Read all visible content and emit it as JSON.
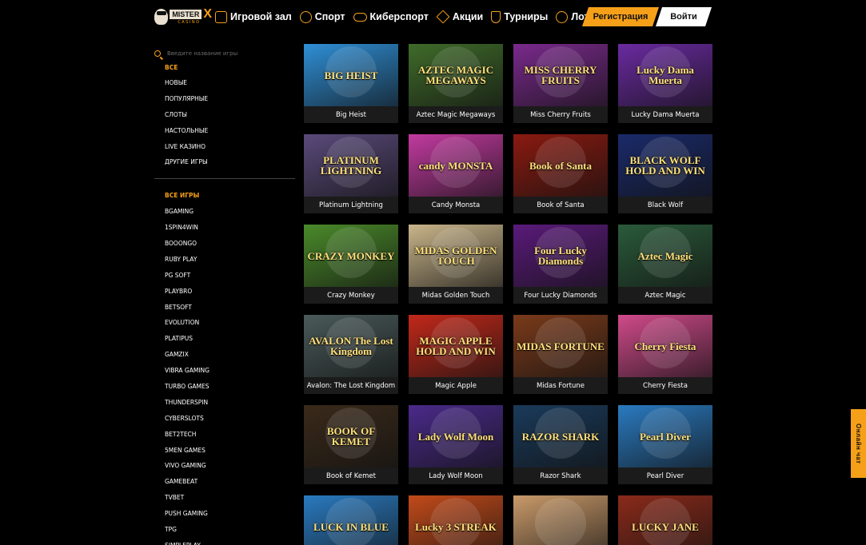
{
  "header": {
    "logo_main": "MISTER",
    "logo_x": "X",
    "logo_sub": "CASINO",
    "nav": [
      {
        "label": "Игровой зал",
        "icon": "slot-machine-icon"
      },
      {
        "label": "Спорт",
        "icon": "ball-icon"
      },
      {
        "label": "Киберспорт",
        "icon": "gamepad-icon"
      },
      {
        "label": "Акции",
        "icon": "diamond-icon"
      },
      {
        "label": "Турниры",
        "icon": "trophy-icon"
      },
      {
        "label": "Лотереи",
        "icon": "lottery-icon"
      }
    ],
    "register_label": "Регистрация",
    "login_label": "Войти"
  },
  "sidebar": {
    "search_placeholder": "Введите название игры",
    "categories": [
      "ВСЕ",
      "НОВЫЕ",
      "ПОПУЛЯРНЫЕ",
      "СЛОТЫ",
      "НАСТОЛЬНЫЕ",
      "LIVE КАЗИНО",
      "ДРУГИЕ ИГРЫ"
    ],
    "providers": [
      "ВСЕ ИГРЫ",
      "BGAMING",
      "1SPIN4WIN",
      "BOOONGO",
      "RUBY PLAY",
      "PG SOFT",
      "PLAYBRO",
      "BETSOFT",
      "EVOLUTION",
      "PLATIPUS",
      "GAMZIX",
      "VIBRA GAMING",
      "TURBO GAMES",
      "THUNDERSPIN",
      "CYBERSLOTS",
      "BET2TECH",
      "5MEN GAMES",
      "VIVO GAMING",
      "GAMEBEAT",
      "TVBET",
      "PUSH GAMING",
      "TPG",
      "SIMPLEPLAY"
    ]
  },
  "games": [
    {
      "name": "Big Heist",
      "logo": "BIG HEIST",
      "bg": "#2f8fd6"
    },
    {
      "name": "Aztec Magic Megaways",
      "logo": "AZTEC MAGIC MEGAWAYS",
      "bg": "#3f6b2a"
    },
    {
      "name": "Miss Cherry Fruits",
      "logo": "MISS CHERRY FRUITS",
      "bg": "#7a2a8c"
    },
    {
      "name": "Lucky Dama Muerta",
      "logo": "Lucky Dama Muerta",
      "bg": "#6a2aa0"
    },
    {
      "name": "Platinum Lightning",
      "logo": "PLATINUM LIGHTNING",
      "bg": "#5a4a7a"
    },
    {
      "name": "Candy Monsta",
      "logo": "candy MONSTA",
      "bg": "#c23aa0"
    },
    {
      "name": "Book of Santa",
      "logo": "Book of Santa",
      "bg": "#8a1a10"
    },
    {
      "name": "Black Wolf",
      "logo": "BLACK WOLF HOLD AND WIN",
      "bg": "#1a2a6a"
    },
    {
      "name": "Crazy Monkey",
      "logo": "CRAZY MONKEY",
      "bg": "#4a8a2a"
    },
    {
      "name": "Midas Golden Touch",
      "logo": "MIDAS GOLDEN TOUCH",
      "bg": "#c9b58a"
    },
    {
      "name": "Four Lucky Diamonds",
      "logo": "Four Lucky Diamonds",
      "bg": "#5a1a7a"
    },
    {
      "name": "Aztec Magic",
      "logo": "Aztec Magic",
      "bg": "#2a5a3a"
    },
    {
      "name": "Avalon: The Lost Kingdom",
      "logo": "AVALON The Lost Kingdom",
      "bg": "#4a5a5a"
    },
    {
      "name": "Magic Apple",
      "logo": "MAGIC APPLE HOLD AND WIN",
      "bg": "#c2281a"
    },
    {
      "name": "Midas Fortune",
      "logo": "MIDAS FORTUNE",
      "bg": "#7a3a1a"
    },
    {
      "name": "Cherry Fiesta",
      "logo": "Cherry Fiesta",
      "bg": "#d04a8a"
    },
    {
      "name": "Book of Kemet",
      "logo": "BOOK OF KEMET",
      "bg": "#3a2a1a"
    },
    {
      "name": "Lady Wolf Moon",
      "logo": "Lady Wolf Moon",
      "bg": "#4a2a8a"
    },
    {
      "name": "Razor Shark",
      "logo": "RAZOR SHARK",
      "bg": "#1a3a5a"
    },
    {
      "name": "Pearl Diver",
      "logo": "Pearl Diver",
      "bg": "#2a7ac0"
    }
  ],
  "partial_games": [
    {
      "logo": "LUCK IN BLUE",
      "bg": "#2a7ac0"
    },
    {
      "logo": "Lucky 3 STREAK",
      "bg": "#c24a1a"
    },
    {
      "logo": "",
      "bg": "#c99a6a"
    },
    {
      "logo": "LUCKY JANE",
      "bg": "#8a2a1a"
    }
  ],
  "chat": {
    "label": "Онлайн чат"
  }
}
